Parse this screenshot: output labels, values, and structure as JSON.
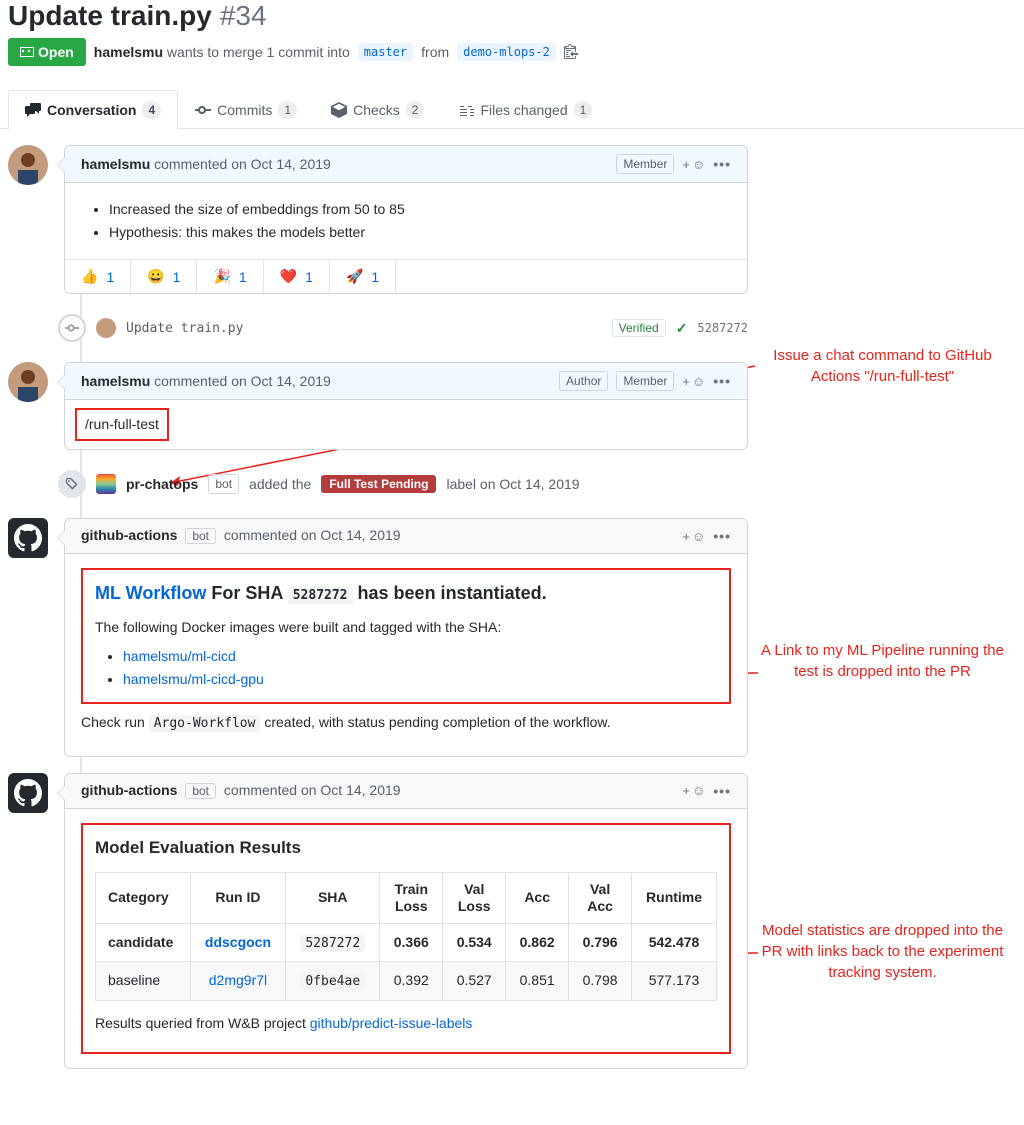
{
  "pr": {
    "title": "Update train.py",
    "number": "#34",
    "state": "Open",
    "author": "hamelsmu",
    "merge_text_1": "wants to merge 1 commit into",
    "base_branch": "master",
    "from": "from",
    "head_branch": "demo-mlops-2"
  },
  "tabs": {
    "conversation": {
      "label": "Conversation",
      "count": "4"
    },
    "commits": {
      "label": "Commits",
      "count": "1"
    },
    "checks": {
      "label": "Checks",
      "count": "2"
    },
    "files": {
      "label": "Files changed",
      "count": "1"
    }
  },
  "comment1": {
    "author": "hamelsmu",
    "verb": "commented",
    "time": "on Oct 14, 2019",
    "badge": "Member",
    "bullets": [
      "Increased the size of embeddings from 50 to 85",
      "Hypothesis: this makes the models better"
    ],
    "reactions": [
      {
        "emoji": "👍",
        "count": "1"
      },
      {
        "emoji": "😀",
        "count": "1"
      },
      {
        "emoji": "🎉",
        "count": "1"
      },
      {
        "emoji": "❤️",
        "count": "1"
      },
      {
        "emoji": "🚀",
        "count": "1"
      }
    ]
  },
  "commit": {
    "msg": "Update train.py",
    "verified": "Verified",
    "sha": "5287272"
  },
  "comment2": {
    "author": "hamelsmu",
    "verb": "commented",
    "time": "on Oct 14, 2019",
    "badge_author": "Author",
    "badge_member": "Member",
    "body": "/run-full-test"
  },
  "label_event": {
    "actor": "pr-chatops",
    "bot": "bot",
    "verb": "added the",
    "label": "Full Test Pending",
    "suffix": "label on Oct 14, 2019"
  },
  "comment3": {
    "author": "github-actions",
    "bot": "bot",
    "verb": "commented",
    "time": "on Oct 14, 2019",
    "workflow_link": "ML Workflow",
    "for_sha": "For SHA",
    "sha": "5287272",
    "instantiated": "has been instantiated.",
    "docker_text": "The following Docker images were built and tagged with the SHA:",
    "images": [
      "hamelsmu/ml-cicd",
      "hamelsmu/ml-cicd-gpu"
    ],
    "check_prefix": "Check run",
    "check_name": "Argo-Workflow",
    "check_suffix": "created, with status pending completion of the workflow."
  },
  "comment4": {
    "author": "github-actions",
    "bot": "bot",
    "verb": "commented",
    "time": "on Oct 14, 2019",
    "title": "Model Evaluation Results",
    "cols": [
      "Category",
      "Run ID",
      "SHA",
      "Train Loss",
      "Val Loss",
      "Acc",
      "Val Acc",
      "Runtime"
    ],
    "rows": [
      {
        "category": "candidate",
        "run_id": "ddscgocn",
        "sha": "5287272",
        "train_loss": "0.366",
        "val_loss": "0.534",
        "acc": "0.862",
        "val_acc": "0.796",
        "runtime": "542.478"
      },
      {
        "category": "baseline",
        "run_id": "d2mg9r7l",
        "sha": "0fbe4ae",
        "train_loss": "0.392",
        "val_loss": "0.527",
        "acc": "0.851",
        "val_acc": "0.798",
        "runtime": "577.173"
      }
    ],
    "footer_prefix": "Results queried from W&B project",
    "footer_link": "github/predict-issue-labels"
  },
  "annotations": {
    "a1": "Issue a chat command to GitHub Actions \"/run-full-test\"",
    "a2": "A Link to my ML Pipeline running the test is dropped into the PR",
    "a3": "Model statistics are dropped into the PR with links back to the experiment tracking system."
  }
}
